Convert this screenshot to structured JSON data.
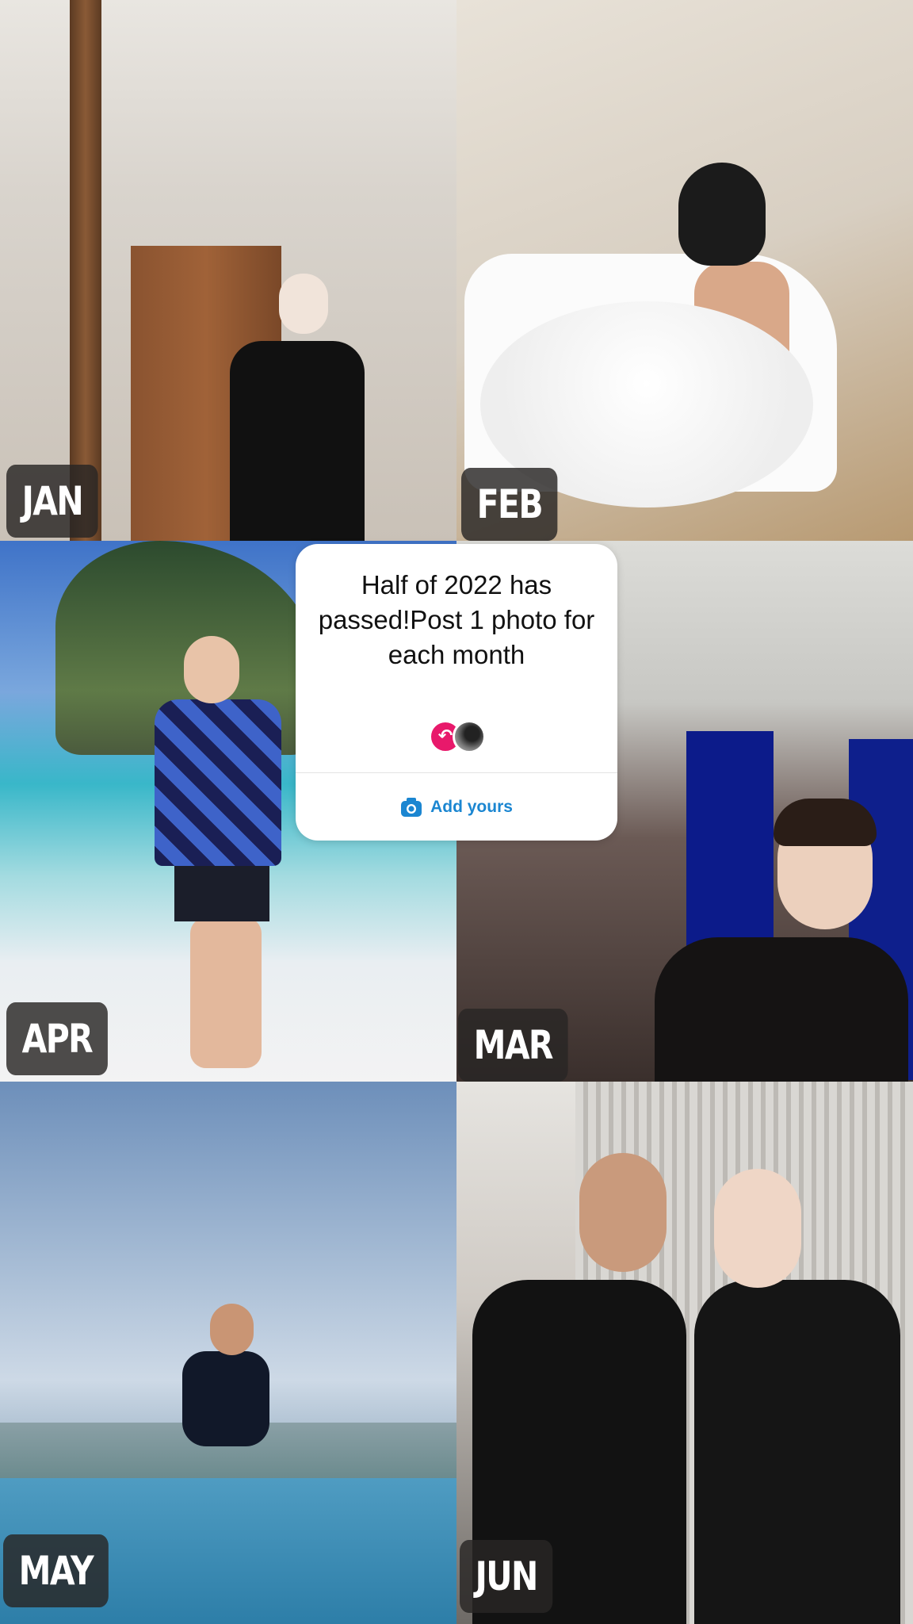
{
  "months": {
    "jan": "JAN",
    "feb": "FEB",
    "apr": "APR",
    "mar": "MAR",
    "may": "MAY",
    "jun": "JUN"
  },
  "sticker": {
    "title": "Half of 2022 has passed!Post 1 photo for each month",
    "action_label": "Add yours",
    "action_icon": "camera-icon",
    "badge_icon": "reply-arrow-icon",
    "badge_color": "#e8196b",
    "action_color": "#1b86d1"
  }
}
